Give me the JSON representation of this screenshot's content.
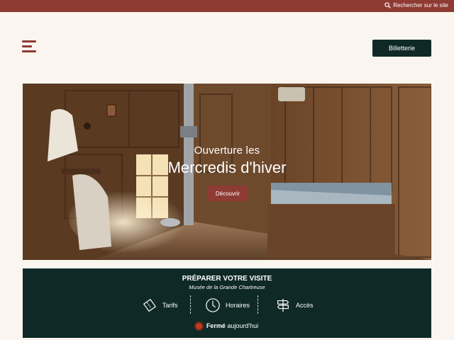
{
  "topbar": {
    "search_label": "Rechercher sur le site",
    "search_icon": "search-icon"
  },
  "header": {
    "menu_icon": "hamburger-menu-icon",
    "ticket_label": "Billetterie"
  },
  "hero": {
    "subtitle": "Ouverture les",
    "title": "Mercredis d'hiver",
    "cta_label": "Découvrir"
  },
  "visit": {
    "title": "PRÉPARER VOTRE VISITE",
    "subtitle": "Musée de la Grande Chartreuse",
    "links": [
      {
        "label": "Tarifs",
        "icon": "ticket-icon"
      },
      {
        "label": "Horaires",
        "icon": "clock-icon"
      },
      {
        "label": "Accès",
        "icon": "signpost-icon"
      }
    ],
    "status_bold": "Fermé",
    "status_rest": "aujourd'hui"
  },
  "colors": {
    "brand": "#8e3b34",
    "dark": "#0f2a26",
    "background": "#faf6ef",
    "status_closed": "#c23a1d"
  }
}
